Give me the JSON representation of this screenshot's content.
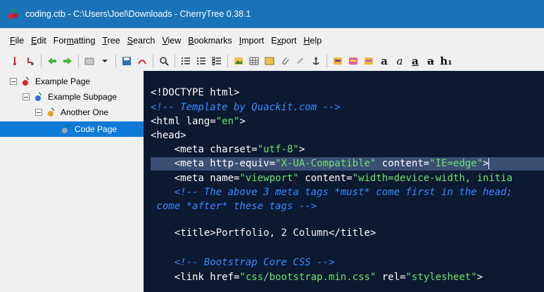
{
  "window": {
    "title": "coding.ctb - C:\\Users\\Joel\\Downloads - CherryTree 0.38.1",
    "icon": "cherry-icon"
  },
  "menu": [
    {
      "pre": "",
      "u": "F",
      "post": "ile"
    },
    {
      "pre": "",
      "u": "E",
      "post": "dit"
    },
    {
      "pre": "For",
      "u": "m",
      "post": "atting"
    },
    {
      "pre": "",
      "u": "T",
      "post": "ree"
    },
    {
      "pre": "",
      "u": "S",
      "post": "earch"
    },
    {
      "pre": "",
      "u": "V",
      "post": "iew"
    },
    {
      "pre": "",
      "u": "B",
      "post": "ookmarks"
    },
    {
      "pre": "",
      "u": "I",
      "post": "mport"
    },
    {
      "pre": "E",
      "u": "x",
      "post": "port"
    },
    {
      "pre": "",
      "u": "H",
      "post": "elp"
    }
  ],
  "toolbar": {
    "bold_label": "a",
    "italic_label": "a",
    "underline_label": "a",
    "strike_label": "a",
    "h1_label": "h₁"
  },
  "tree": [
    {
      "label": "Example Page",
      "level": 0,
      "expanded": true,
      "icon": "cherry-red-icon",
      "selected": false
    },
    {
      "label": "Example Subpage",
      "level": 1,
      "expanded": true,
      "icon": "cherry-blue-icon",
      "selected": false
    },
    {
      "label": "Another One",
      "level": 2,
      "expanded": true,
      "icon": "cherry-orange-icon",
      "selected": false
    },
    {
      "label": "Code Page",
      "level": 3,
      "expanded": false,
      "icon": "cherry-gray-icon",
      "selected": true
    }
  ],
  "code": {
    "l1": "<!DOCTYPE html>",
    "l2": "<!-- Template by Quackit.com -->",
    "l3_tag_open": "<html lang=",
    "l3_val": "\"en\"",
    "l3_tag_close": ">",
    "l4": "<head>",
    "l5_open": "    <meta charset=",
    "l5_val": "\"utf-8\"",
    "l5_close": ">",
    "l6_lt": "    <",
    "l6_open": "meta http-equiv=",
    "l6_val1": "\"X-UA-Compatible\"",
    "l6_mid": " content=",
    "l6_val2": "\"IE=edge\"",
    "l6_close": ">",
    "l7_open": "    <meta name=",
    "l7_val1": "\"viewport\"",
    "l7_mid": " content=",
    "l7_val2": "\"width=device-width, initia",
    "l8": "    <!-- The above 3 meta tags *must* come first in the head;",
    "l9": " come *after* these tags -->",
    "l10_open": "    <title>",
    "l10_text": "Portfolio, 2 Column",
    "l10_close": "</title>",
    "l11": "    <!-- Bootstrap Core CSS -->",
    "l12_open": "    <link href=",
    "l12_val1": "\"css/bootstrap.min.css\"",
    "l12_mid": " rel=",
    "l12_val2": "\"stylesheet\"",
    "l12_close": ">"
  },
  "colors": {
    "titlebar": "#1a73b8",
    "editor_bg": "#0b1931",
    "selection": "#0e7ad8",
    "string": "#6de36d",
    "comment": "#3a8cff"
  }
}
